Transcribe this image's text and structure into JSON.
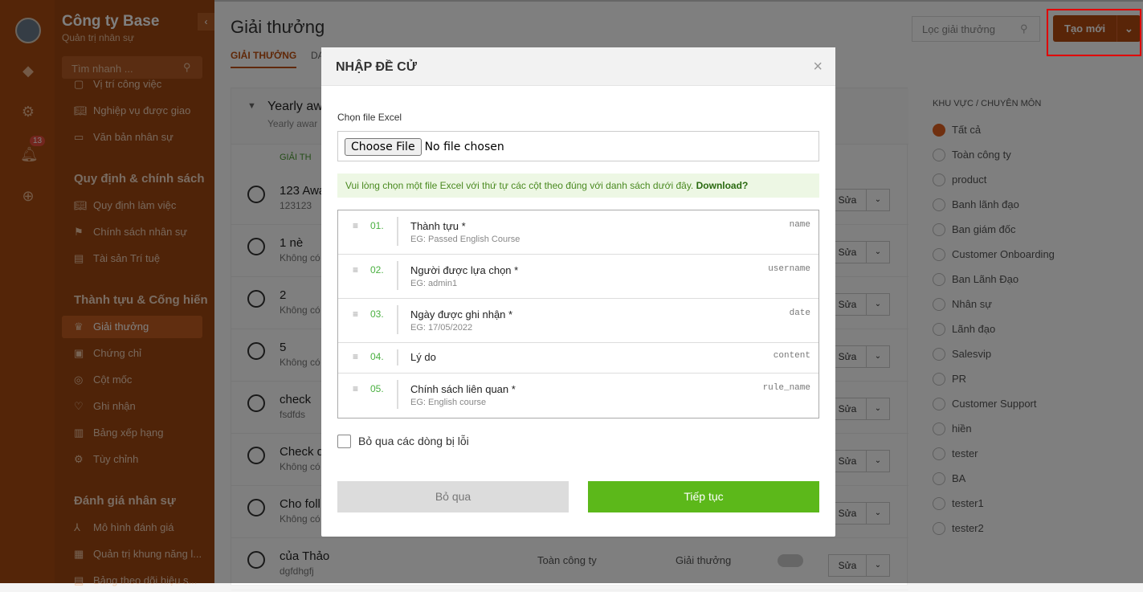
{
  "company": {
    "name": "Công ty Base",
    "subtitle": "Quản trị nhân sự"
  },
  "rail": {
    "notif_count": "13"
  },
  "sidebar": {
    "search_placeholder": "Tìm nhanh ...",
    "items_top": [
      {
        "label": "Vị trí công việc",
        "icon": "briefcase-icon"
      },
      {
        "label": "Nghiệp vụ được giao",
        "icon": "book-icon"
      },
      {
        "label": "Văn bản nhân sự",
        "icon": "folder-icon"
      }
    ],
    "group2": "Quy định & chính sách",
    "items_policy": [
      {
        "label": "Quy định làm việc",
        "icon": "book-icon"
      },
      {
        "label": "Chính sách nhân sự",
        "icon": "flag-icon"
      },
      {
        "label": "Tài sản Trí tuệ",
        "icon": "document-icon"
      }
    ],
    "group3": "Thành tựu & Cống hiến",
    "items_achieve": [
      {
        "label": "Giải thưởng",
        "icon": "crown-icon"
      },
      {
        "label": "Chứng chỉ",
        "icon": "certificate-icon"
      },
      {
        "label": "Cột mốc",
        "icon": "target-icon"
      },
      {
        "label": "Ghi nhận",
        "icon": "heart-icon"
      },
      {
        "label": "Bảng xếp hạng",
        "icon": "chart-icon"
      },
      {
        "label": "Tùy chỉnh",
        "icon": "gear-icon"
      }
    ],
    "group4": "Đánh giá nhân sự",
    "items_eval": [
      {
        "label": "Mô hình đánh giá",
        "icon": "model-icon"
      },
      {
        "label": "Quản trị khung năng l...",
        "icon": "grid-icon"
      },
      {
        "label": "Bảng theo dõi hiệu s...",
        "icon": "table-icon"
      }
    ]
  },
  "main": {
    "title": "Giải thưởng",
    "tab_active": "GIẢI THƯỞNG",
    "tab2": "DA",
    "filter_placeholder": "Lọc giải thưởng",
    "new_button": "Tạo mới",
    "yearly": {
      "title": "Yearly aw",
      "sub": "Yearly awar"
    },
    "col_header": "GIẢI TH",
    "edit_label": "Sửa",
    "awards": [
      {
        "name": "123 Awa",
        "desc": "123123"
      },
      {
        "name": "1 nè",
        "desc": "Không có"
      },
      {
        "name": "2",
        "desc": "Không có"
      },
      {
        "name": "5",
        "desc": "Không có"
      },
      {
        "name": "check",
        "desc": "fsdfds"
      },
      {
        "name": "Check q",
        "desc": "Không có"
      },
      {
        "name": "Cho foll",
        "desc": "Không có"
      },
      {
        "name": "của Thảo",
        "desc": "dgfdhgfj",
        "scope": "Toàn công ty",
        "type": "Giải thưởng"
      }
    ]
  },
  "right_panel": {
    "heading": "KHU VỰC / CHUYÊN MÔN",
    "options": [
      "Tất cả",
      "Toàn công ty",
      "product",
      "Banh lãnh đạo",
      "Ban giám đốc",
      "Customer Onboarding",
      "Ban Lãnh Đạo",
      "Nhân sự",
      "Lãnh đạo",
      "Salesvip",
      "PR",
      "Customer Support",
      "hiền",
      "tester",
      "BA",
      "tester1",
      "tester2"
    ]
  },
  "modal": {
    "title": "NHẬP ĐỀ CỬ",
    "file_label": "Chọn file Excel",
    "choose_file": "Choose File",
    "no_file": "No file chosen",
    "note_text": "Vui lòng chọn một file Excel với thứ tự các cột theo đúng với danh sách dưới đây.",
    "note_link": "Download?",
    "columns": [
      {
        "num": "01.",
        "name": "Thành tựu *",
        "eg": "EG: Passed English Course",
        "key": "name"
      },
      {
        "num": "02.",
        "name": "Người được lựa chọn *",
        "eg": "EG: admin1",
        "key": "username"
      },
      {
        "num": "03.",
        "name": "Ngày được ghi nhận *",
        "eg": "EG: 17/05/2022",
        "key": "date"
      },
      {
        "num": "04.",
        "name": "Lý do",
        "eg": "",
        "key": "content"
      },
      {
        "num": "05.",
        "name": "Chính sách liên quan *",
        "eg": "EG: English course",
        "key": "rule_name"
      }
    ],
    "skip_label": "Bỏ qua các dòng bị lỗi",
    "cancel": "Bỏ qua",
    "continue": "Tiếp tục"
  }
}
